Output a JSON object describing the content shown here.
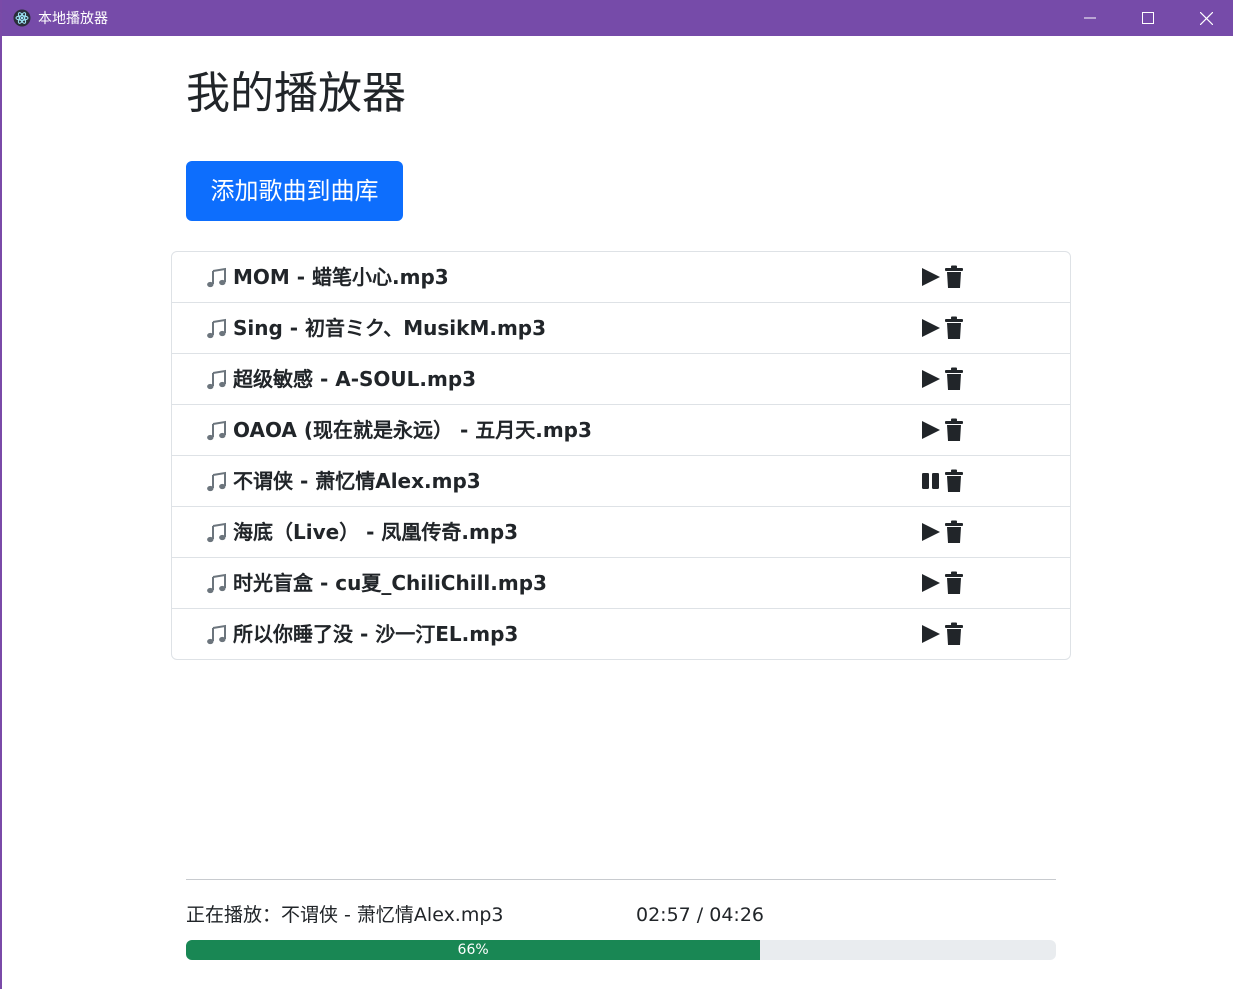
{
  "window": {
    "title": "本地播放器"
  },
  "header": {
    "title": "我的播放器",
    "add_button_label": "添加歌曲到曲库"
  },
  "songs": [
    {
      "name": "MOM - 蜡笔小心.mp3",
      "state": "play"
    },
    {
      "name": "Sing - 初音ミク、MusikM.mp3",
      "state": "play"
    },
    {
      "name": "超级敏感 - A-SOUL.mp3",
      "state": "play"
    },
    {
      "name": "OAOA (现在就是永远） - 五月天.mp3",
      "state": "play"
    },
    {
      "name": "不谓侠 - 萧忆情Alex.mp3",
      "state": "pause"
    },
    {
      "name": "海底（Live） - 凤凰传奇.mp3",
      "state": "play"
    },
    {
      "name": "时光盲盒 - cu夏_ChiliChill.mp3",
      "state": "play"
    },
    {
      "name": "所以你睡了没 - 沙一汀EL.mp3",
      "state": "play"
    }
  ],
  "player": {
    "now_playing_text": "正在播放：不谓侠 - 萧忆情Alex.mp3",
    "time_text": "02:57 / 04:26",
    "progress_percent": 66,
    "progress_label": "66%"
  },
  "icons": {
    "song": "music-note-icon",
    "play": "play-icon",
    "pause": "pause-icon",
    "delete": "trash-icon"
  },
  "colors": {
    "titlebar": "#764ba9",
    "primary": "#0d6efd",
    "progress": "#198754",
    "track": "#e9ecef"
  }
}
